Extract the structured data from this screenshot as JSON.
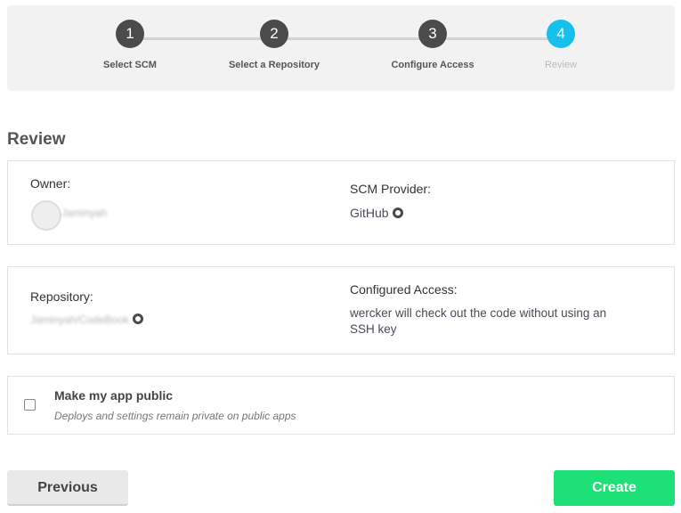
{
  "steps": [
    {
      "number": "1",
      "label": "Select SCM"
    },
    {
      "number": "2",
      "label": "Select a Repository"
    },
    {
      "number": "3",
      "label": "Configure Access"
    },
    {
      "number": "4",
      "label": "Review"
    }
  ],
  "page_title": "Review",
  "owner": {
    "label": "Owner:",
    "name": "Jaminyah"
  },
  "scm": {
    "label": "SCM Provider:",
    "value": "GitHub",
    "icon": "github-icon"
  },
  "repository": {
    "label": "Repository:",
    "value": "Jaminyah/CodeBook",
    "icon": "github-icon"
  },
  "access": {
    "label": "Configured Access:",
    "line1": "wercker will check out the code without using an",
    "line2": "SSH key"
  },
  "public": {
    "title": "Make my app public",
    "description": "Deploys and settings remain private on public apps",
    "checked": false
  },
  "buttons": {
    "previous": "Previous",
    "create": "Create"
  },
  "colors": {
    "active_step": "#17c0ea",
    "create_button": "#1de076",
    "step_done": "#4b4b4b"
  }
}
